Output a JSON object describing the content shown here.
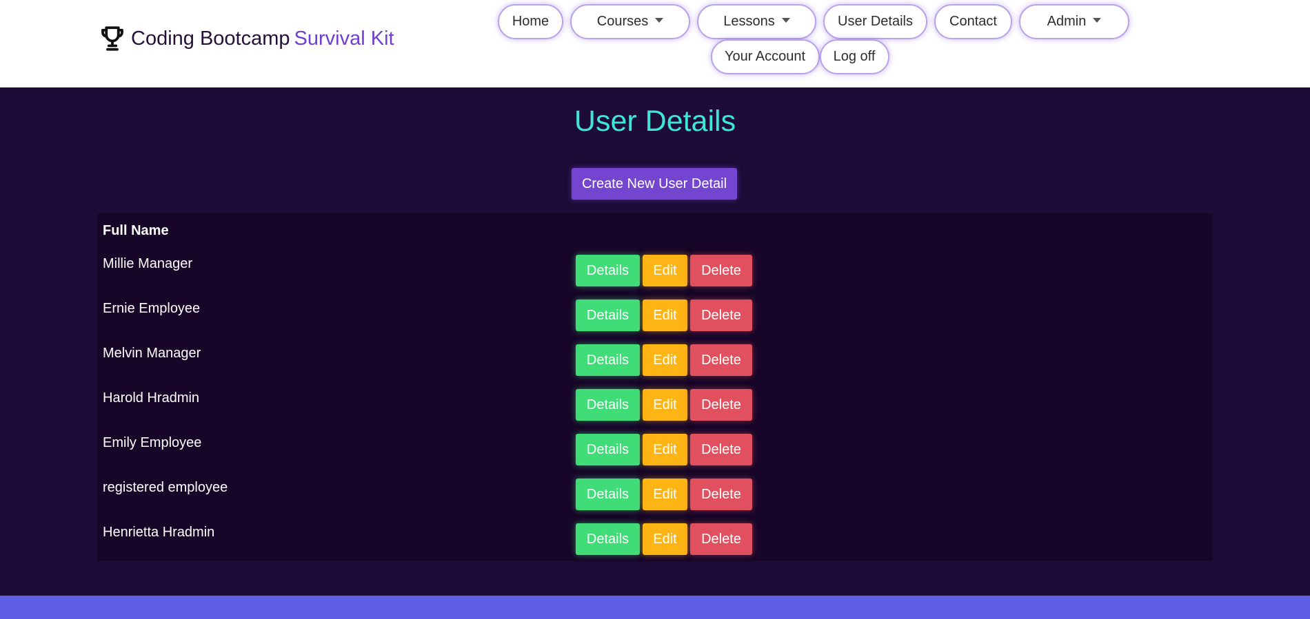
{
  "brand": {
    "name_main": "Coding Bootcamp",
    "name_accent": "Survival Kit",
    "icon": "trophy-icon"
  },
  "nav": {
    "home": "Home",
    "courses": "Courses",
    "lessons": "Lessons",
    "user_details": "User Details",
    "contact": "Contact",
    "admin": "Admin",
    "your_account": "Your Account",
    "log_off": "Log off"
  },
  "page": {
    "title": "User Details",
    "create_button": "Create New User Detail"
  },
  "table": {
    "column_header": "Full Name",
    "action_labels": {
      "details": "Details",
      "edit": "Edit",
      "delete": "Delete"
    },
    "rows": [
      {
        "name": "Millie Manager"
      },
      {
        "name": "Ernie Employee"
      },
      {
        "name": "Melvin Manager"
      },
      {
        "name": "Harold Hradmin"
      },
      {
        "name": "Emily Employee"
      },
      {
        "name": "registered employee"
      },
      {
        "name": "Henrietta Hradmin"
      }
    ]
  },
  "colors": {
    "page_background": "#1d0b38",
    "title": "#3ee6d9",
    "primary": "#7445cf",
    "success": "#3fdc78",
    "warning": "#fdb516",
    "danger": "#e0505e",
    "footer": "#5f5fe6"
  }
}
